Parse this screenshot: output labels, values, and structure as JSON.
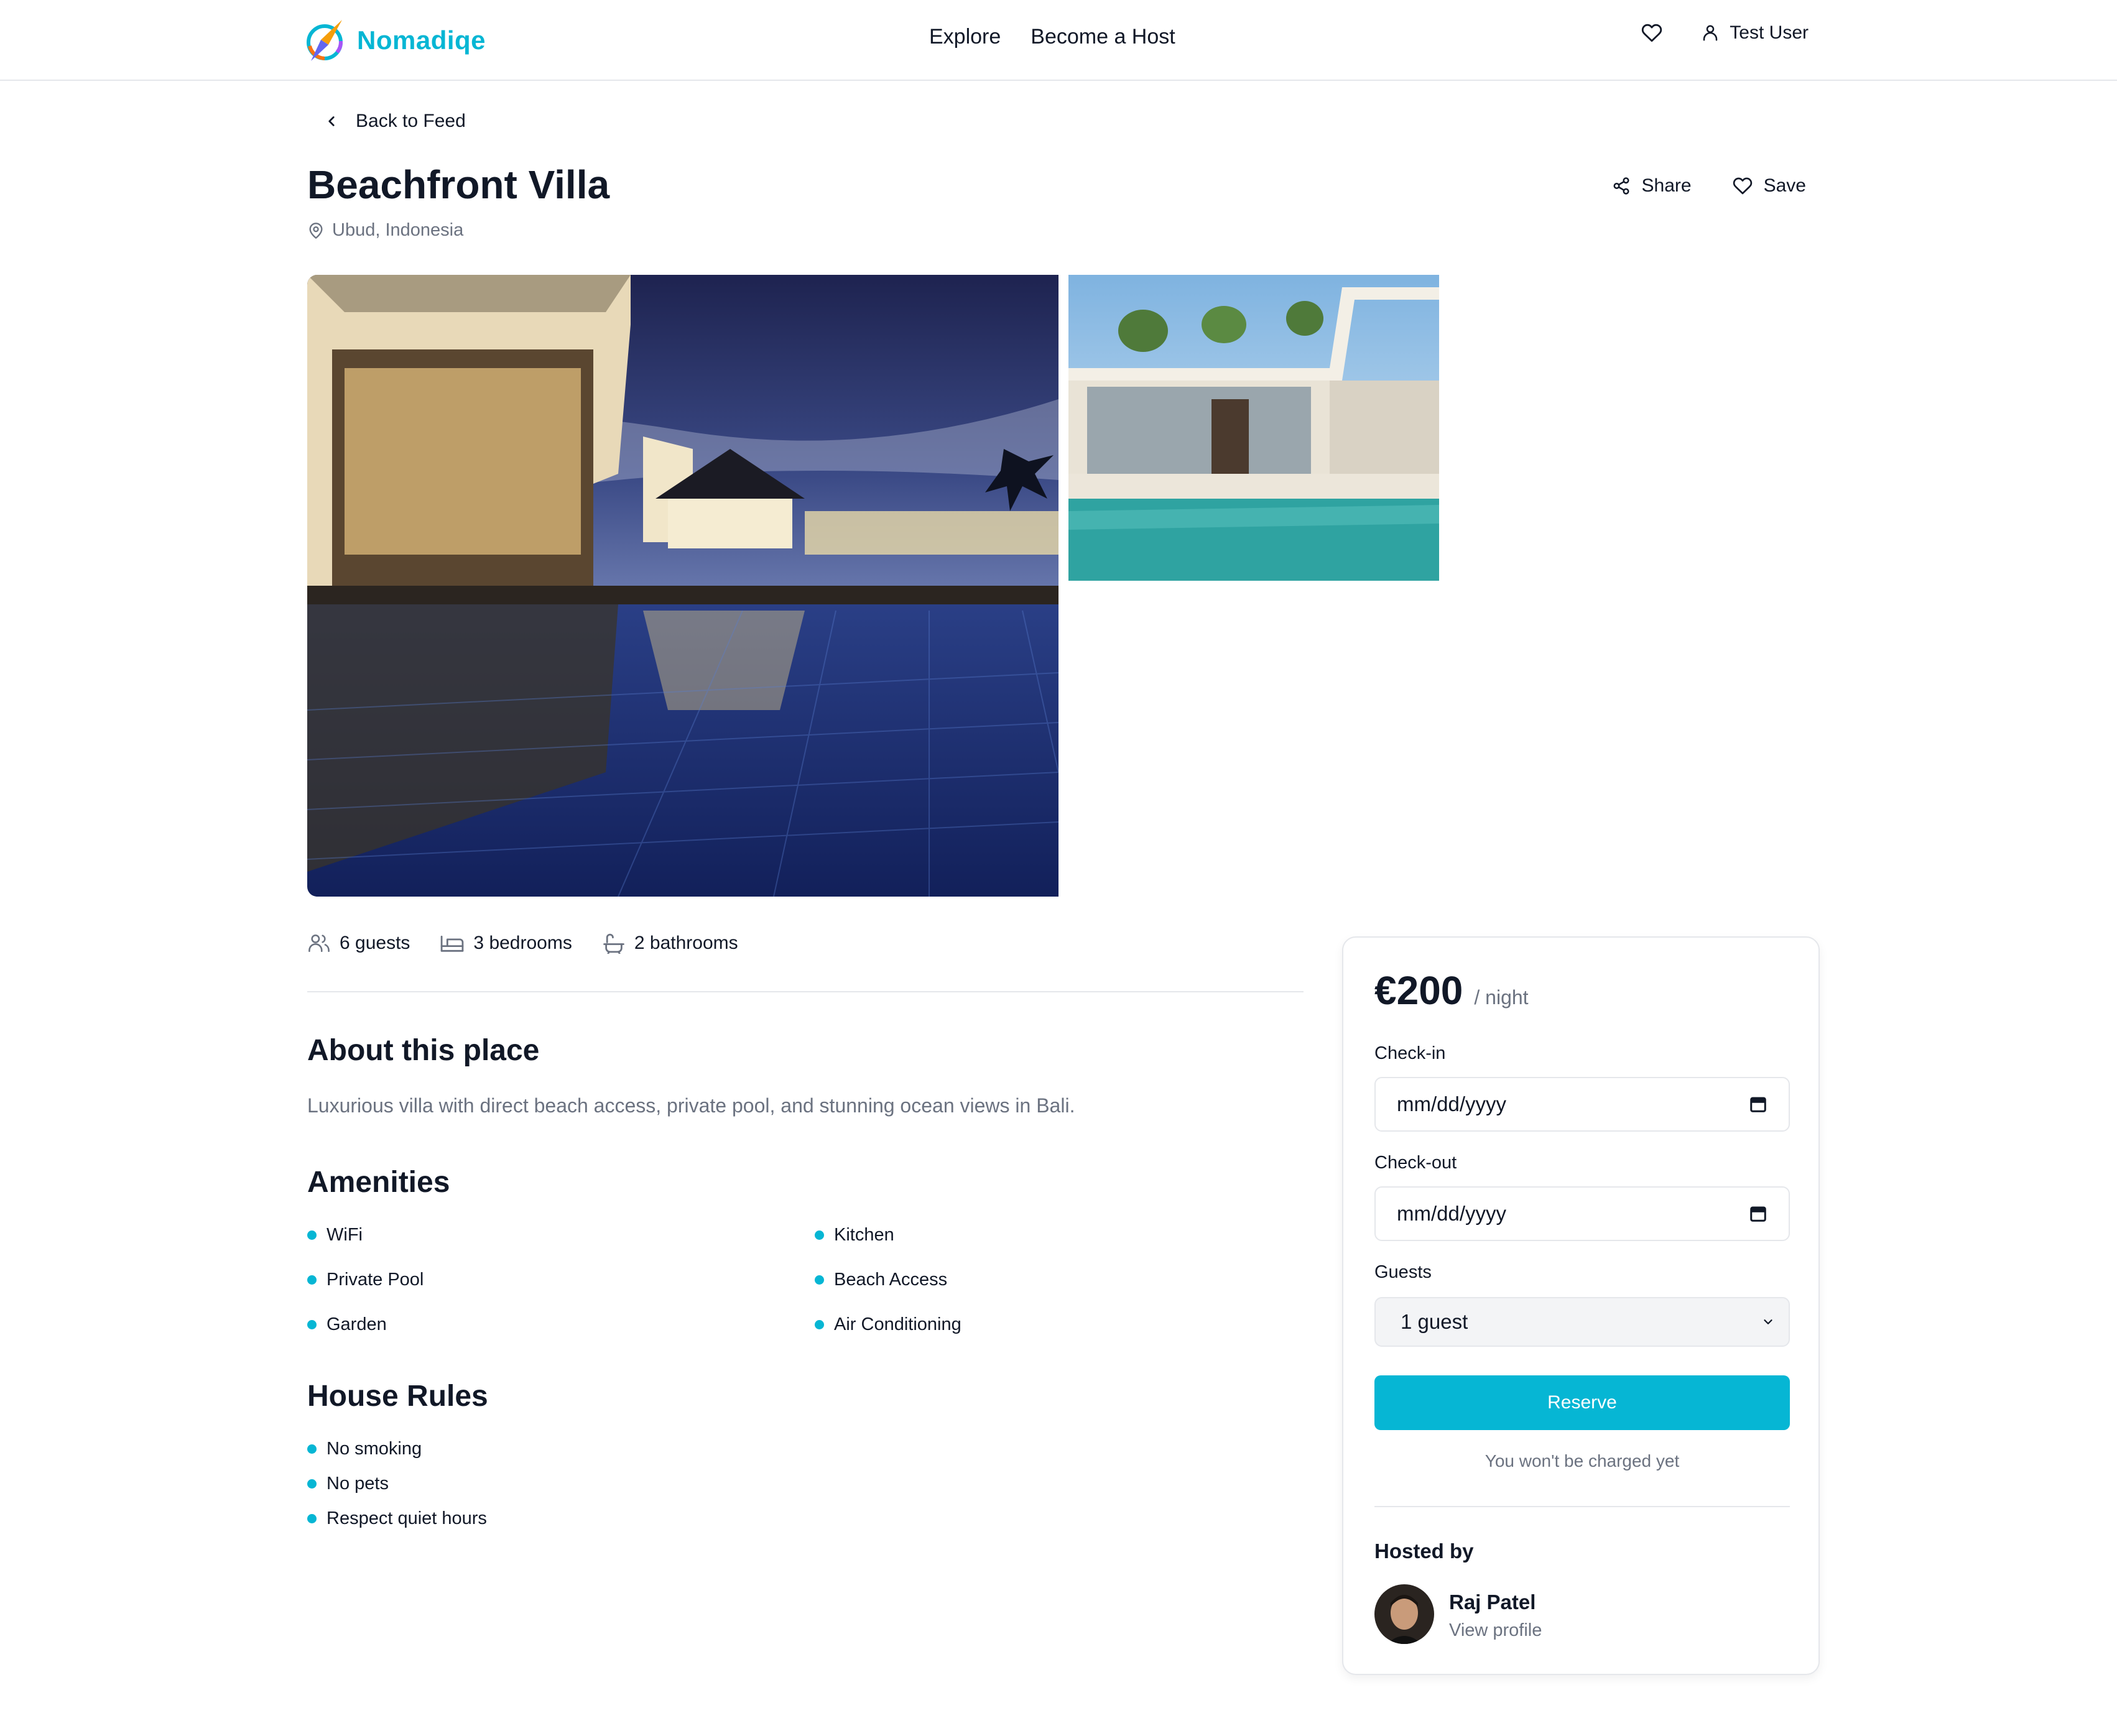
{
  "brand": {
    "name": "Nomadiqe",
    "accent": "#06b6d4"
  },
  "nav": {
    "explore": "Explore",
    "become_host": "Become a Host"
  },
  "user": {
    "name": "Test User"
  },
  "back": {
    "label": "Back to Feed"
  },
  "listing": {
    "title": "Beachfront Villa",
    "location": "Ubud, Indonesia",
    "share_label": "Share",
    "save_label": "Save",
    "stats": {
      "guests": "6 guests",
      "bedrooms": "3 bedrooms",
      "bathrooms": "2 bathrooms"
    },
    "about_heading": "About this place",
    "about_text": "Luxurious villa with direct beach access, private pool, and stunning ocean views in Bali.",
    "amenities_heading": "Amenities",
    "amenities": [
      "WiFi",
      "Kitchen",
      "Private Pool",
      "Beach Access",
      "Garden",
      "Air Conditioning"
    ],
    "rules_heading": "House Rules",
    "rules": [
      "No smoking",
      "No pets",
      "Respect quiet hours"
    ]
  },
  "booking": {
    "price": "€200",
    "unit": "/ night",
    "checkin_label": "Check-in",
    "checkin_value": "mm/dd/yyyy",
    "checkout_label": "Check-out",
    "checkout_value": "mm/dd/yyyy",
    "guests_label": "Guests",
    "guests_value": "1 guest",
    "reserve_label": "Reserve",
    "note": "You won't be charged yet",
    "hosted_by": "Hosted by",
    "host_name": "Raj Patel",
    "host_link": "View profile"
  }
}
